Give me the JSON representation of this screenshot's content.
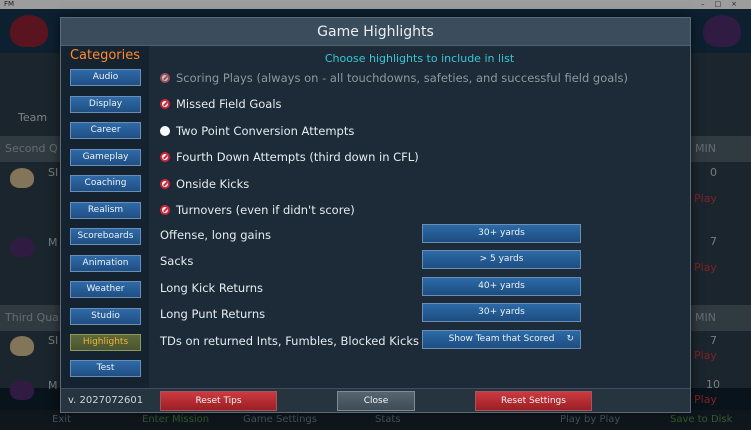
{
  "window": {
    "title": "FM"
  },
  "background": {
    "team_label": "Team",
    "band_second": "Second Q",
    "band_third": "Third Qua",
    "right_min": "MIN",
    "left_rows": [
      "SI",
      "M",
      "SI",
      "M"
    ],
    "right_rows": [
      {
        "num": "0",
        "play": "Play"
      },
      {
        "num": "7",
        "play": "Play"
      },
      {
        "num": "7",
        "play": "Play"
      },
      {
        "num": "10",
        "play": "Play"
      }
    ],
    "bottom_items": [
      "Exit",
      "Enter Mission",
      "Game Settings",
      "Stats",
      "Play by Play",
      "Save to Disk"
    ]
  },
  "dialog": {
    "title": "Game Highlights",
    "categories_title": "Categories",
    "categories": [
      {
        "label": "Audio",
        "active": false
      },
      {
        "label": "Display",
        "active": false
      },
      {
        "label": "Career",
        "active": false
      },
      {
        "label": "Gameplay",
        "active": false
      },
      {
        "label": "Coaching",
        "active": false
      },
      {
        "label": "Realism",
        "active": false
      },
      {
        "label": "Scoreboards",
        "active": false
      },
      {
        "label": "Animation",
        "active": false
      },
      {
        "label": "Weather",
        "active": false
      },
      {
        "label": "Studio",
        "active": false
      },
      {
        "label": "Highlights",
        "active": true
      },
      {
        "label": "Test",
        "active": false
      }
    ],
    "heading": "Choose highlights to include in list",
    "options": [
      {
        "label": "Scoring Plays (always on - all touchdowns, safeties, and successful field goals)",
        "state": "disabled"
      },
      {
        "label": "Missed Field Goals",
        "state": "checked"
      },
      {
        "label": "Two Point Conversion Attempts",
        "state": "unchecked"
      },
      {
        "label": "Fourth Down Attempts (third down in CFL)",
        "state": "checked"
      },
      {
        "label": "Onside Kicks",
        "state": "checked"
      },
      {
        "label": "Turnovers (even if didn't score)",
        "state": "checked"
      }
    ],
    "selects": [
      {
        "label": "Offense, long gains",
        "value": "30+ yards"
      },
      {
        "label": "Sacks",
        "value": "> 5 yards"
      },
      {
        "label": "Long Kick Returns",
        "value": "40+ yards"
      },
      {
        "label": "Long Punt Returns",
        "value": "30+ yards"
      },
      {
        "label": "TDs on returned Ints, Fumbles, Blocked Kicks",
        "value": "Show Team that Scored"
      }
    ],
    "version": "v. 2027072601",
    "buttons": {
      "reset_tips": "Reset Tips",
      "close": "Close",
      "reset_settings": "Reset Settings"
    }
  },
  "colors": {
    "accent_orange": "#ff8b2a",
    "heading_cyan": "#34c8d8",
    "button_blue": "#2c6aa7",
    "button_red": "#cc3a3f"
  }
}
